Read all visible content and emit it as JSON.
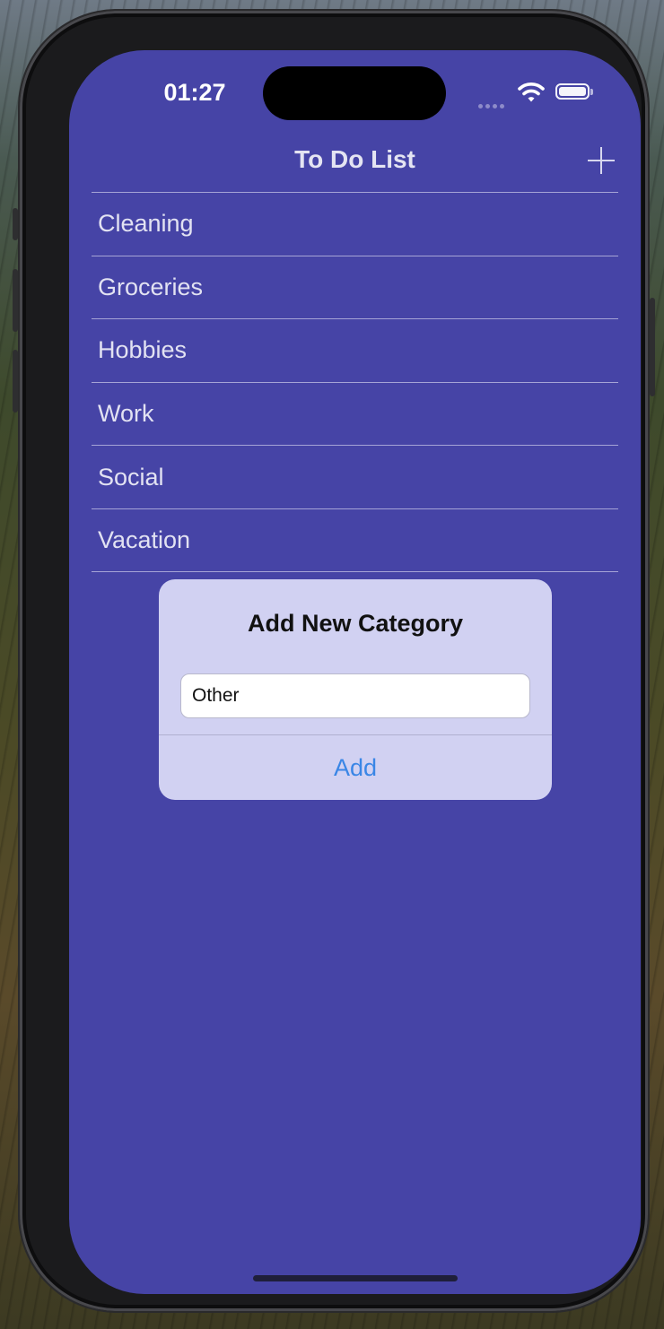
{
  "status": {
    "time": "01:27"
  },
  "nav": {
    "title": "To Do List"
  },
  "categories": [
    "Cleaning",
    "Groceries",
    "Hobbies",
    "Work",
    "Social",
    "Vacation"
  ],
  "alert": {
    "title": "Add New Category",
    "input_value": "Other",
    "add_label": "Add"
  },
  "colors": {
    "screen_background": "#4644a6",
    "alert_background": "#d1d1f2",
    "accent": "#3a86e6"
  }
}
